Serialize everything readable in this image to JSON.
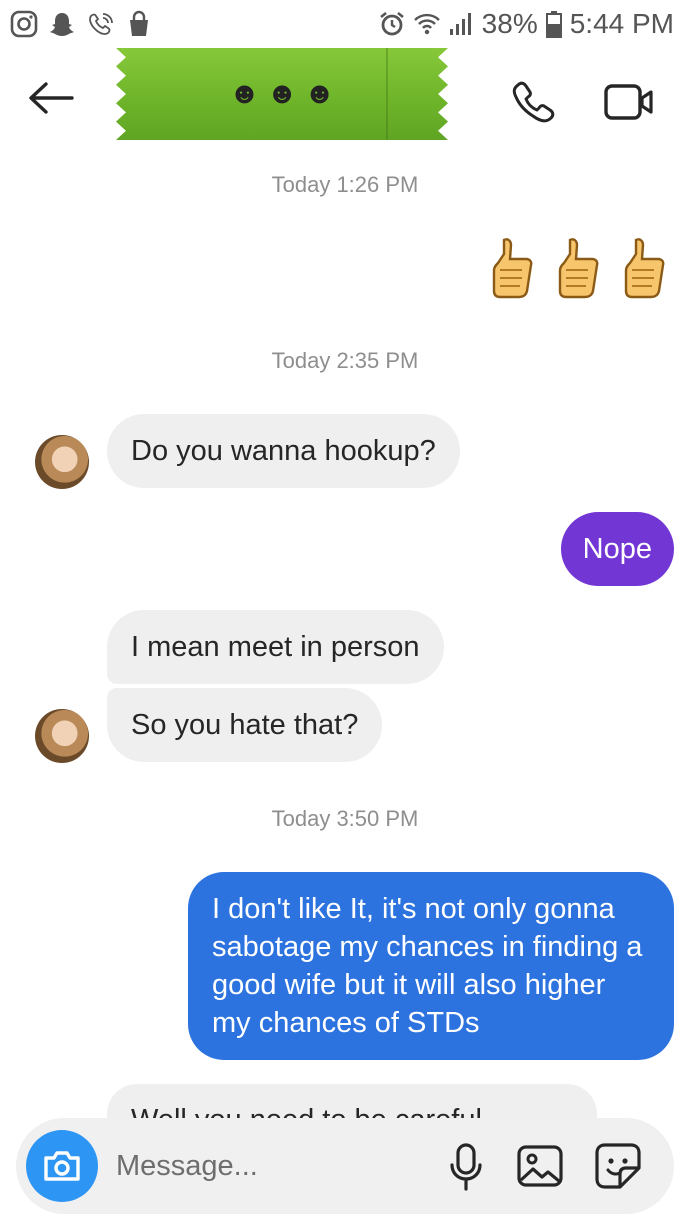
{
  "status_bar": {
    "battery": "38%",
    "time": "5:44 PM",
    "left_icons": [
      "instagram-icon",
      "snapchat-icon",
      "wifi-calling-icon",
      "shopping-bag-icon"
    ],
    "right_icons": [
      "alarm-icon",
      "wifi-icon",
      "signal-icon",
      "battery-icon"
    ]
  },
  "header": {
    "title_emoji": [
      "☻",
      "☻",
      "☻"
    ],
    "banner_color": "#6fb52a"
  },
  "chat": {
    "timestamps": [
      "Today 1:26 PM",
      "Today 2:35 PM",
      "Today 3:50 PM"
    ],
    "thumbs": [
      "👍",
      "👍",
      "👍"
    ],
    "messages": [
      {
        "from": "them",
        "text": "Do you wanna hookup?"
      },
      {
        "from": "me",
        "text": "Nope"
      },
      {
        "from": "them",
        "text": "I mean meet in person"
      },
      {
        "from": "them",
        "text": "So you hate that?"
      },
      {
        "from": "me",
        "text": "I don't like It, it's not only gonna sabotage my chances in finding a good wife but it will also higher my chances of STDs"
      },
      {
        "from": "them",
        "text": "Well you need to be careful"
      }
    ]
  },
  "composer": {
    "placeholder": "Message..."
  },
  "colors": {
    "outgoing_purple": "#7236d4",
    "outgoing_blue": "#2c73df",
    "incoming_gray": "#efefef",
    "camera_blue": "#2d95f3"
  }
}
